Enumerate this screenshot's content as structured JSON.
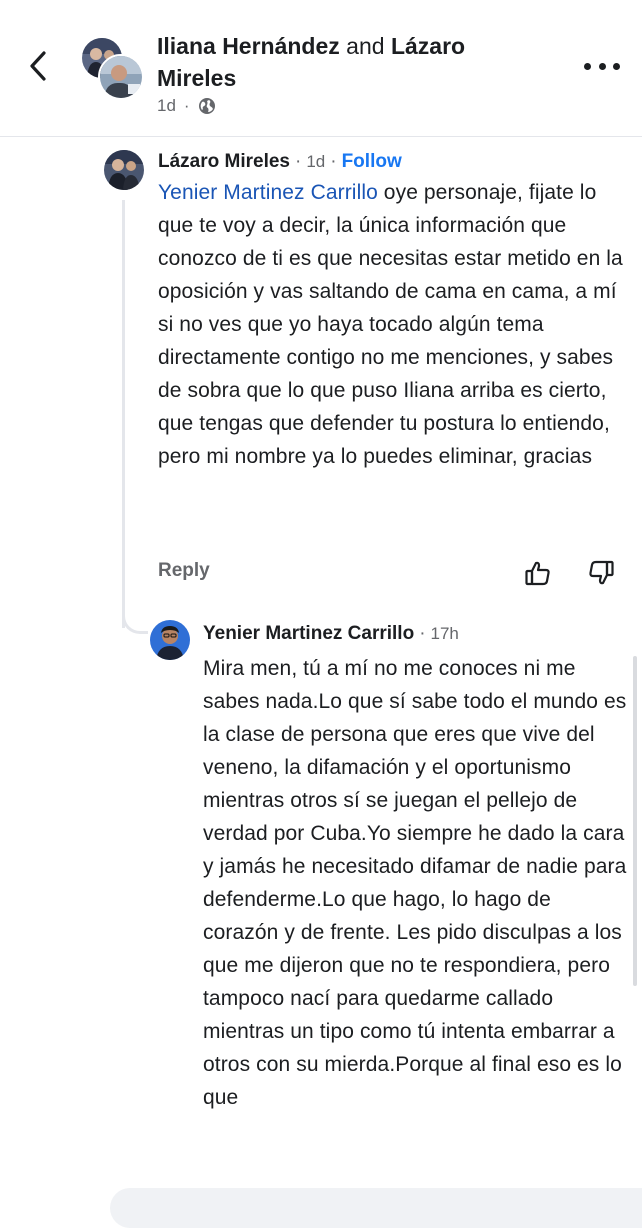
{
  "header": {
    "person1": "Iliana Hernández",
    "conjunction": "and",
    "person2": "Lázaro Mireles",
    "age": "1d",
    "privacy_icon": "globe-icon",
    "back_icon": "chevron-left-icon",
    "more_icon": "more-horizontal-icon"
  },
  "comments": [
    {
      "author": "Lázaro Mireles",
      "separator": "·",
      "time": "1d",
      "follow_label": "Follow",
      "mention": "Yenier Martinez Carrillo",
      "text": " oye personaje, fijate lo que te voy a decir, la única información que conozco de ti es que necesitas estar metido en la oposición y vas saltando de cama en cama, a mí si no ves que yo haya tocado algún tema directamente contigo no me menciones, y sabes de sobra que lo que puso Iliana arriba es cierto, que tengas que defender tu postura lo entiendo, pero mi nombre ya lo puedes eliminar, gracias",
      "reply_label": "Reply",
      "upvote_icon": "thumbs-up-icon",
      "downvote_icon": "thumbs-down-icon"
    },
    {
      "author": "Yenier Martinez Carrillo",
      "separator": "·",
      "time": "17h",
      "text": "Mira men, tú a mí no me conoces ni me sabes nada.Lo que sí sabe todo el mundo es la clase de persona que eres que vive del veneno, la difamación y el oportunismo mientras otros sí se juegan el pellejo de verdad por Cuba.Yo siempre he dado la cara y jamás he necesitado difamar de nadie para defenderme.Lo que hago, lo hago de corazón y de frente. Les pido disculpas a los que me dijeron que no te respondiera, pero tampoco nací para quedarme callado mientras un tipo como tú intenta embarrar a otros con su mierda.Porque al final eso es lo que"
    }
  ],
  "colors": {
    "text": "#1c1e21",
    "secondary": "#65676b",
    "link": "#1877f2",
    "mention": "#1a55b5",
    "divider": "#e4e6eb"
  }
}
